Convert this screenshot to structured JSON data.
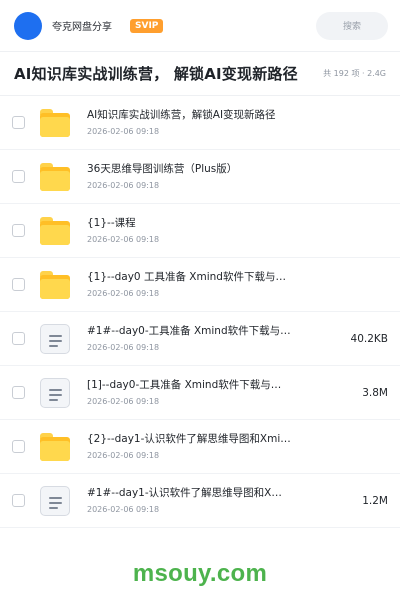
{
  "header": {
    "user_name": "夸克网盘分享",
    "badge": "SVIP",
    "search_label": "搜索"
  },
  "title_row": {
    "title": "AI知识库实战训练营， 解锁AI变现新路径",
    "meta": "共 192 项 · 2.4G"
  },
  "files": [
    {
      "type": "folder",
      "name": "AI知识库实战训练营，解锁AI变现新路径",
      "date": "2026-02-06 09:18",
      "size": ""
    },
    {
      "type": "folder",
      "name": "36天思维导图训练营（Plus版）",
      "date": "2026-02-06 09:18",
      "size": ""
    },
    {
      "type": "folder",
      "name": "{1}--课程",
      "date": "2026-02-06 09:18",
      "size": ""
    },
    {
      "type": "folder",
      "name": "{1}--day0 工具准备 Xmind软件下载与…",
      "date": "2026-02-06 09:18",
      "size": ""
    },
    {
      "type": "doc",
      "name": "#1#--day0-工具准备 Xmind软件下载与…",
      "date": "2026-02-06 09:18",
      "size": "40.2KB"
    },
    {
      "type": "doc",
      "name": "[1]--day0-工具准备 Xmind软件下载与…",
      "date": "2026-02-06 09:18",
      "size": "3.8M"
    },
    {
      "type": "folder",
      "name": "{2}--day1-认识软件了解思维导图和Xmind",
      "date": "2026-02-06 09:18",
      "size": ""
    },
    {
      "type": "doc",
      "name": "#1#--day1-认识软件了解思维导图和Xmin…",
      "date": "2026-02-06 09:18",
      "size": "1.2M"
    }
  ],
  "watermark": "msouy.com",
  "colors": {
    "avatar": "#1e6ff0",
    "badge": "#ff9f2e",
    "folder": "#ffbf26",
    "watermark": "#4db34d"
  },
  "icons": {
    "folder": "folder-icon",
    "doc": "document-icon"
  }
}
